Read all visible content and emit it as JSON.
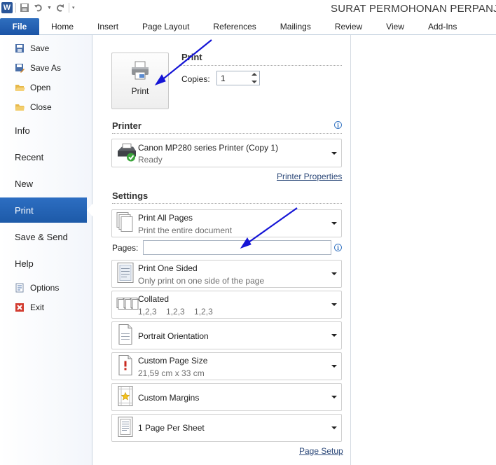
{
  "window": {
    "title": "SURAT PERMOHONAN PERPANJAN",
    "app_icon_letter": "W"
  },
  "ribbon": {
    "file_tab": "File",
    "tabs": [
      "Home",
      "Insert",
      "Page Layout",
      "References",
      "Mailings",
      "Review",
      "View",
      "Add-Ins"
    ]
  },
  "nav": {
    "commands": [
      "Save",
      "Save As",
      "Open",
      "Close"
    ],
    "items": [
      "Info",
      "Recent",
      "New",
      "Print",
      "Save & Send",
      "Help"
    ],
    "active_item": "Print",
    "bottom_commands": [
      "Options",
      "Exit"
    ]
  },
  "print": {
    "heading": "Print",
    "button_label": "Print",
    "copies_label": "Copies:",
    "copies_value": "1"
  },
  "printer": {
    "heading": "Printer",
    "name": "Canon MP280 series Printer (Copy 1)",
    "status": "Ready",
    "properties_link": "Printer Properties"
  },
  "settings": {
    "heading": "Settings",
    "pages_label": "Pages:",
    "pages_value": "",
    "print_range": {
      "title": "Print All Pages",
      "subtitle": "Print the entire document"
    },
    "sides": {
      "title": "Print One Sided",
      "subtitle": "Only print on one side of the page"
    },
    "collation": {
      "title": "Collated",
      "subtitle": "1,2,3    1,2,3    1,2,3"
    },
    "orientation": {
      "title": "Portrait Orientation"
    },
    "page_size": {
      "title": "Custom Page Size",
      "subtitle": "21,59 cm x 33 cm"
    },
    "margins": {
      "title": "Custom Margins"
    },
    "pages_per_sheet": {
      "title": "1 Page Per Sheet"
    },
    "page_setup_link": "Page Setup"
  },
  "colors": {
    "accent": "#1d5aa8",
    "annotation_arrow": "#1515d6"
  }
}
